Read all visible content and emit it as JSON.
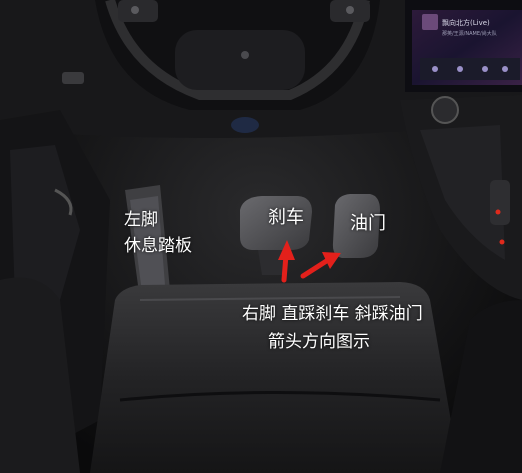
{
  "annotations": {
    "footrest_line1": "左脚",
    "footrest_line2": "休息踏板",
    "brake": "刹车",
    "throttle": "油门",
    "caption_line1": "右脚 直踩刹车 斜踩油门",
    "caption_line2": "箭头方向图示"
  },
  "screen": {
    "song_title": "飘向北方(Live)",
    "artist": "那英/王源/NAME/尚大队"
  },
  "colors": {
    "arrow": "#e3201b",
    "label_text": "#ffffff",
    "background": "#0c0c0d"
  }
}
